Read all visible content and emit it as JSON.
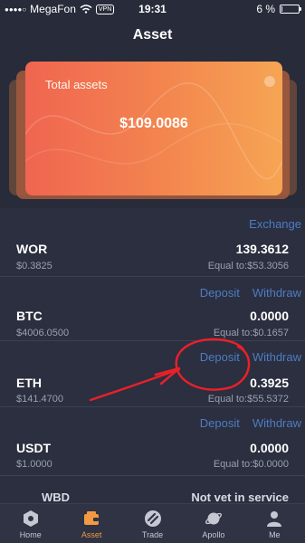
{
  "status_bar": {
    "carrier": "MegaFon",
    "vpn": "VPN",
    "time": "19:31",
    "battery": "6 %",
    "battery_level": 0.06
  },
  "header": {
    "title": "Asset"
  },
  "summary": {
    "label": "Total assets",
    "value": "$109.0086"
  },
  "assets": [
    {
      "symbol": "WOR",
      "price": "$0.3825",
      "amount": "139.3612",
      "equal": "Equal to:$53.3056",
      "actions": [
        "Exchange"
      ]
    },
    {
      "symbol": "BTC",
      "price": "$4006.0500",
      "amount": "0.0000",
      "equal": "Equal to:$0.1657",
      "actions": [
        "Deposit",
        "Withdraw"
      ]
    },
    {
      "symbol": "ETH",
      "price": "$141.4700",
      "amount": "0.3925",
      "equal": "Equal to:$55.5372",
      "actions": [
        "Deposit",
        "Withdraw"
      ]
    },
    {
      "symbol": "USDT",
      "price": "$1.0000",
      "amount": "0.0000",
      "equal": "Equal to:$0.0000",
      "actions": [
        "Deposit",
        "Withdraw"
      ]
    }
  ],
  "partial_asset": {
    "symbol": "WBD",
    "status": "Not vet in service"
  },
  "tabs": [
    {
      "label": "Home",
      "icon": "hexagon-icon",
      "active": false
    },
    {
      "label": "Asset",
      "icon": "wallet-icon",
      "active": true
    },
    {
      "label": "Trade",
      "icon": "exchange-icon",
      "active": false
    },
    {
      "label": "Apollo",
      "icon": "planet-icon",
      "active": false
    },
    {
      "label": "Me",
      "icon": "person-icon",
      "active": false
    }
  ],
  "colors": {
    "background": "#2b2f3f",
    "card_gradient_start": "#f06550",
    "card_gradient_end": "#f6a554",
    "action_link": "#4e7cc4",
    "active_tab": "#f39843",
    "annotation": "#e8202a"
  }
}
